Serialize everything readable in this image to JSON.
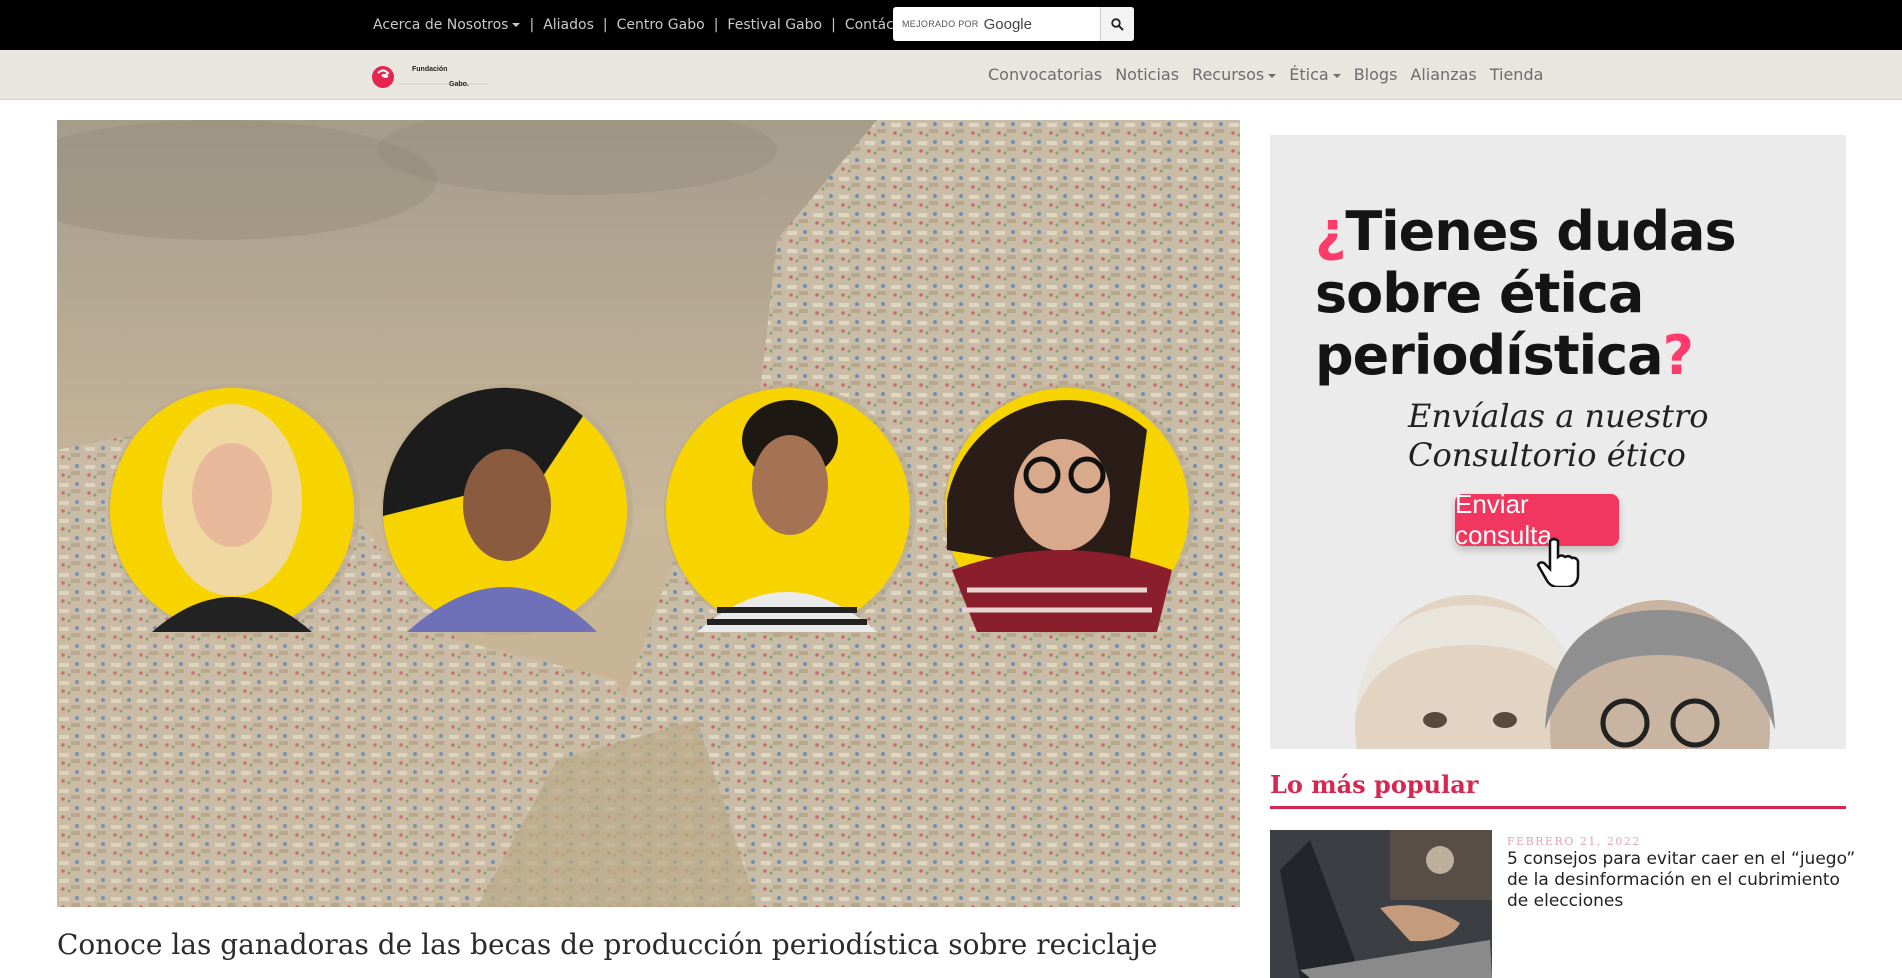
{
  "top_bar": {
    "links": [
      {
        "label": "Acerca de Nosotros",
        "dropdown": true
      },
      {
        "label": "Aliados"
      },
      {
        "label": "Centro Gabo"
      },
      {
        "label": "Festival Gabo"
      },
      {
        "label": "Contáctenos"
      }
    ],
    "separator": "|",
    "search": {
      "brand": "MEJORADO POR",
      "engine": "Google",
      "button_icon": "search-icon"
    }
  },
  "nav": {
    "logo": {
      "icon": "fundacion-gabo-logo",
      "lines": [
        "Fundación",
        "Gabo."
      ]
    },
    "items": [
      {
        "label": "Convocatorias"
      },
      {
        "label": "Noticias"
      },
      {
        "label": "Recursos",
        "dropdown": true
      },
      {
        "label": "Ética",
        "dropdown": true
      },
      {
        "label": "Blogs"
      },
      {
        "label": "Alianzas"
      },
      {
        "label": "Tienda"
      }
    ]
  },
  "hero": {
    "headline": "Conoce las ganadoras de las becas de producción periodística sobre reciclaje",
    "portrait_count": 4,
    "accent_color": "#f7d400"
  },
  "ad": {
    "title_mark_open": "¿",
    "title": [
      "Tienes dudas",
      "sobre ética",
      "periodística"
    ],
    "title_mark_close": "?",
    "subtitle": [
      "Envíalas a nuestro",
      "Consultorio ético"
    ],
    "button": "Enviar consulta",
    "accent_color": "#f1365f"
  },
  "popular": {
    "title": "Lo más popular",
    "items": [
      {
        "date": "FEBRERO 21, 2022",
        "title": "5 consejos para evitar caer en el “juego” de la desinformación en el cubrimiento de elecciones"
      }
    ]
  },
  "colors": {
    "brand": "#d7264f",
    "topbar": "#000000",
    "navbar": "#e9e6df"
  }
}
